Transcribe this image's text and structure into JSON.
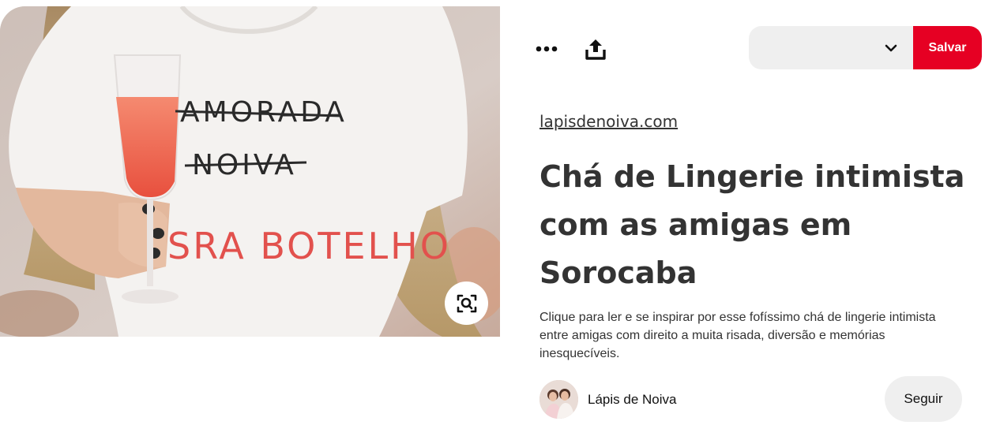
{
  "toolbar": {
    "more_icon": "ellipsis-icon",
    "share_icon": "share-upload-icon"
  },
  "board_select": {
    "selected_value": "",
    "chevron_icon": "chevron-down-icon"
  },
  "save_button": {
    "label": "Salvar",
    "color": "#e60023"
  },
  "pin": {
    "image_shirt_text": [
      "AMORADA",
      "NOIVA",
      "SRA BOTELHO"
    ],
    "visual_search_icon": "visual-search-icon",
    "source_link": "lapisdenoiva.com",
    "title": "Chá de Lingerie intimista com as amigas em Sorocaba",
    "description": "Clique para ler e se inspirar por esse fofíssimo chá de lingerie intimista entre amigas com direito a muita risada, diversão e memórias inesquecíveis."
  },
  "creator": {
    "name": "Lápis de Noiva",
    "follow_label": "Seguir"
  }
}
